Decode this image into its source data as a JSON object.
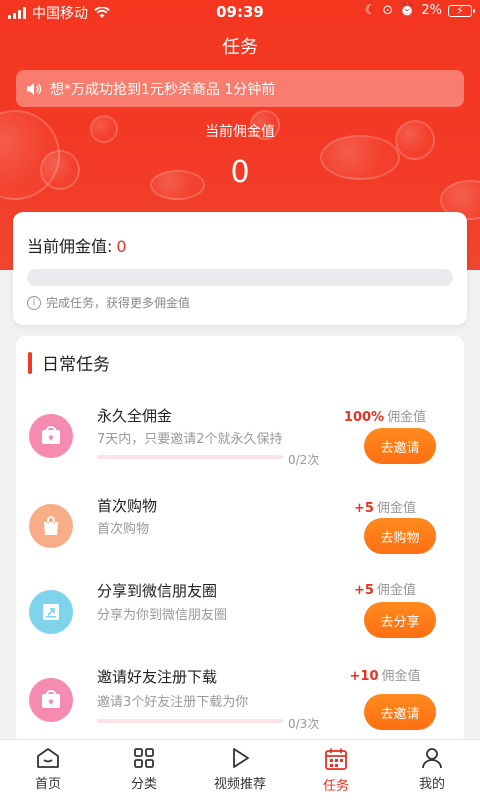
{
  "status_bar": {
    "carrier": "中国移动",
    "time": "09:39",
    "battery": "2%"
  },
  "header": {
    "title": "任务",
    "notice": "想*万成功抢到1元秒杀商品 1分钟前",
    "label": "当前佣金值",
    "value": "0"
  },
  "summary_card": {
    "title": "当前佣金值:",
    "value": "0",
    "progress": 0,
    "tip": "完成任务，获得更多佣金值"
  },
  "daily_tasks": {
    "title": "日常任务",
    "items": [
      {
        "name": "永久全佣金",
        "desc": "7天内，只要邀请2个就永久保持",
        "reward": "100%",
        "reward_unit": "佣金值",
        "button": "去邀请",
        "progress_text": "0/2次",
        "progress": 0,
        "icon": "gift-bag-icon",
        "icon_color": "#f58bb0"
      },
      {
        "name": "首次购物",
        "desc": "首次购物",
        "reward": "+5",
        "reward_unit": "佣金值",
        "button": "去购物",
        "icon": "shopping-bag-icon",
        "icon_color": "#f7ad86"
      },
      {
        "name": "分享到微信朋友圈",
        "desc": "分享为你到微信朋友圈",
        "reward": "+5",
        "reward_unit": "佣金值",
        "button": "去分享",
        "icon": "share-icon",
        "icon_color": "#7fd3ea"
      },
      {
        "name": "邀请好友注册下载",
        "desc": "邀请3个好友注册下载为你",
        "reward": "+10",
        "reward_unit": "佣金值",
        "button": "去邀请",
        "progress_text": "0/3次",
        "progress": 0,
        "icon": "gift-bag-icon",
        "icon_color": "#f58bb0"
      }
    ]
  },
  "tab_bar": {
    "tabs": [
      {
        "label": "首页",
        "icon": "home-icon"
      },
      {
        "label": "分类",
        "icon": "grid-icon"
      },
      {
        "label": "视频推荐",
        "icon": "play-icon"
      },
      {
        "label": "任务",
        "icon": "calendar-icon",
        "active": true
      },
      {
        "label": "我的",
        "icon": "user-icon"
      }
    ]
  },
  "colors": {
    "brand_red": "#f33a26",
    "button_orange": "#ff7a18",
    "reward_red": "#e53222"
  }
}
